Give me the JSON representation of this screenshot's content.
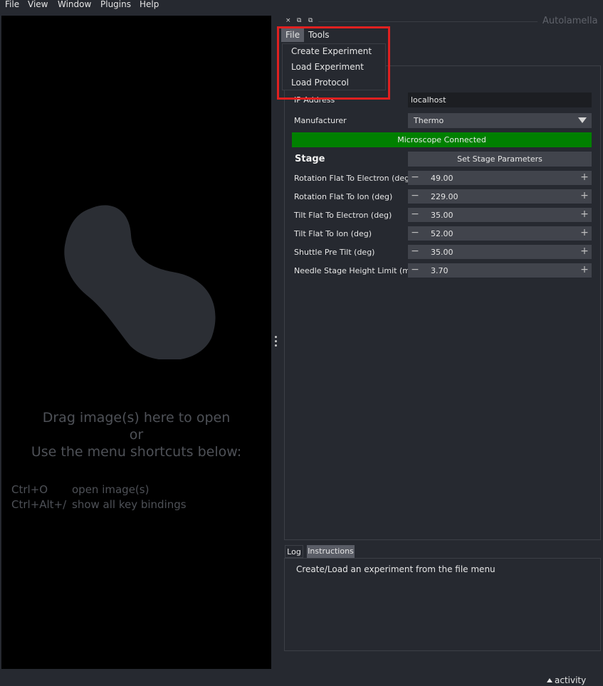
{
  "menubar": {
    "items": [
      "File",
      "View",
      "Window",
      "Plugins",
      "Help"
    ]
  },
  "canvas": {
    "welcome_lines": [
      "Drag image(s) here to open",
      "or",
      "Use the menu shortcuts below:"
    ],
    "shortcuts": [
      {
        "keys": "Ctrl+O",
        "desc": "open image(s)"
      },
      {
        "keys": "Ctrl+Alt+/",
        "desc": "show all key bindings"
      }
    ]
  },
  "dock": {
    "title": "Autolamella",
    "buttons": [
      "×",
      "⧉",
      "⧉"
    ]
  },
  "plugin_menu": {
    "tabs": [
      "File",
      "Tools"
    ],
    "items": [
      "Create Experiment",
      "Load Experiment",
      "Load Protocol"
    ]
  },
  "connection": {
    "ip_label": "IP Address",
    "ip_value": "localhost",
    "manufacturer_label": "Manufacturer",
    "manufacturer_value": "Thermo",
    "status": "Microscope Connected",
    "status_color": "#008000"
  },
  "stage": {
    "title": "Stage",
    "button": "Set Stage Parameters",
    "params": [
      {
        "label": "Rotation Flat To Electron (deg)",
        "value": "49.00"
      },
      {
        "label": "Rotation Flat To Ion (deg)",
        "value": "229.00"
      },
      {
        "label": "Tilt Flat To Electron (deg)",
        "value": "35.00"
      },
      {
        "label": "Tilt Flat To Ion (deg)",
        "value": "52.00"
      },
      {
        "label": "Shuttle Pre Tilt (deg)",
        "value": "35.00"
      },
      {
        "label": "Needle Stage Height Limit (mm)",
        "value": "3.70"
      }
    ]
  },
  "log": {
    "tabs": [
      "Log",
      "Instructions"
    ],
    "active_tab": "Instructions",
    "text": "Create/Load an experiment from the file menu"
  },
  "statusbar": {
    "activity": "activity"
  },
  "colors": {
    "highlight": "#e02020",
    "background": "#262930"
  }
}
